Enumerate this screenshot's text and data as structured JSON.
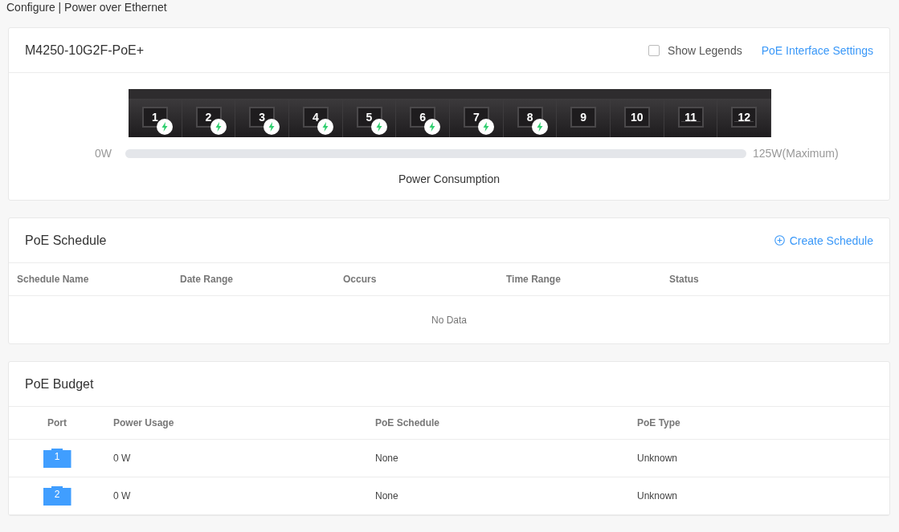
{
  "breadcrumb": "Configure | Power over Ethernet",
  "device": {
    "model": "M4250-10G2F-PoE+",
    "show_legends": {
      "label": "Show Legends",
      "checked": false
    },
    "settings_link": "PoE Interface Settings",
    "ports": [
      {
        "label": "1",
        "kind": "rj45",
        "poe": true
      },
      {
        "label": "2",
        "kind": "rj45",
        "poe": true
      },
      {
        "label": "3",
        "kind": "rj45",
        "poe": true
      },
      {
        "label": "4",
        "kind": "rj45",
        "poe": true
      },
      {
        "label": "5",
        "kind": "rj45",
        "poe": true
      },
      {
        "label": "6",
        "kind": "rj45",
        "poe": true
      },
      {
        "label": "7",
        "kind": "rj45",
        "poe": true
      },
      {
        "label": "8",
        "kind": "rj45",
        "poe": true
      },
      {
        "label": "9",
        "kind": "rj45",
        "poe": false
      },
      {
        "label": "10",
        "kind": "rj45",
        "poe": false
      },
      {
        "label": "11",
        "kind": "sfp",
        "poe": false
      },
      {
        "label": "12",
        "kind": "sfp",
        "poe": false
      }
    ],
    "power": {
      "min": "0W",
      "max": "125W(Maximum)",
      "level": 0,
      "caption": "Power Consumption"
    }
  },
  "schedule": {
    "title": "PoE Schedule",
    "create": "Create Schedule",
    "columns": [
      "Schedule Name",
      "Date Range",
      "Occurs",
      "Time Range",
      "Status"
    ],
    "empty": "No Data"
  },
  "budget": {
    "title": "PoE Budget",
    "columns": [
      "Port",
      "Power Usage",
      "PoE Schedule",
      "PoE Type"
    ],
    "rows": [
      {
        "port": "1",
        "usage": "0 W",
        "schedule": "None",
        "type": "Unknown"
      },
      {
        "port": "2",
        "usage": "0 W",
        "schedule": "None",
        "type": "Unknown"
      }
    ]
  }
}
